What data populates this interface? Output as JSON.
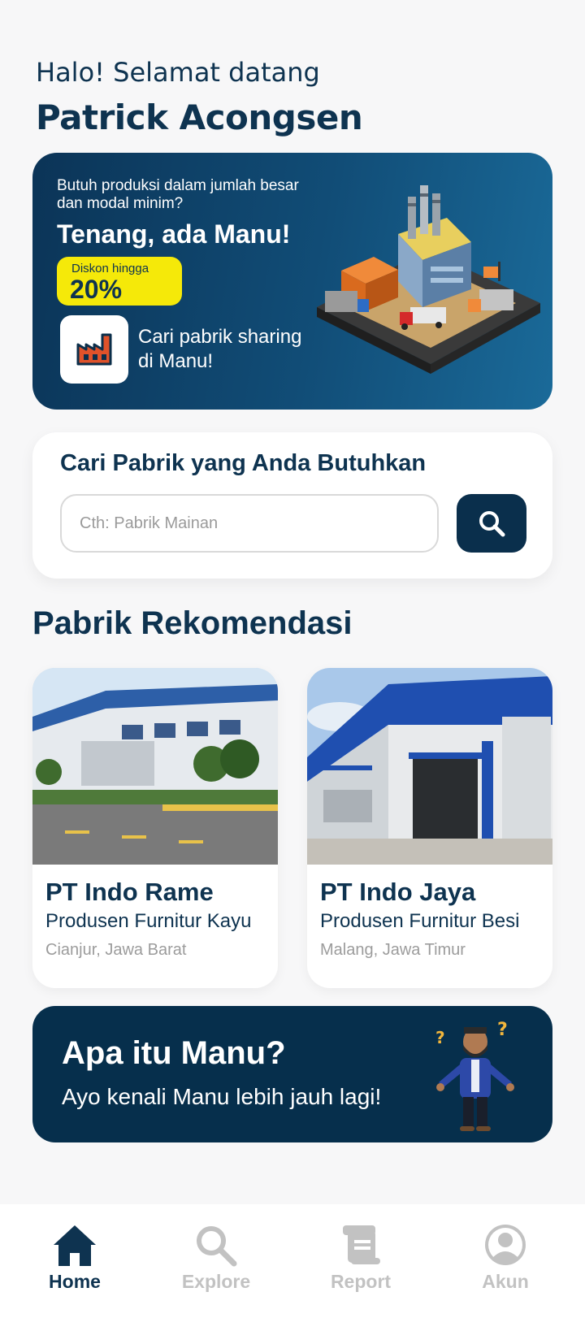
{
  "greeting": "Halo! Selamat datang",
  "user_name": "Patrick Acongsen",
  "banner": {
    "question": "Butuh produksi dalam jumlah besar dan modal minim?",
    "headline": "Tenang, ada Manu!",
    "promo_label": "Diskon hingga",
    "promo_value": "20%",
    "cta_text": "Cari pabrik sharing di Manu!",
    "icon": "factory-icon"
  },
  "search": {
    "title": "Cari Pabrik yang Anda Butuhkan",
    "placeholder": "Cth: Pabrik Mainan",
    "value": "",
    "button_icon": "search-icon"
  },
  "recommendations": {
    "title": "Pabrik Rekomendasi",
    "items": [
      {
        "name": "PT Indo Rame",
        "description": "Produsen Furnitur Kayu",
        "location": "Cianjur, Jawa Barat"
      },
      {
        "name": "PT Indo Jaya",
        "description": "Produsen Furnitur Besi",
        "location": "Malang, Jawa Timur"
      }
    ]
  },
  "about": {
    "title": "Apa itu Manu?",
    "subtitle": "Ayo kenali Manu lebih jauh lagi!"
  },
  "nav": {
    "items": [
      {
        "label": "Home",
        "icon": "home-icon",
        "active": true
      },
      {
        "label": "Explore",
        "icon": "search-icon",
        "active": false
      },
      {
        "label": "Report",
        "icon": "report-icon",
        "active": false
      },
      {
        "label": "Akun",
        "icon": "account-icon",
        "active": false
      }
    ]
  },
  "colors": {
    "primary": "#0e3350",
    "accent_yellow": "#f5e909",
    "background": "#f7f7f8",
    "inactive": "#c2c2c2"
  }
}
